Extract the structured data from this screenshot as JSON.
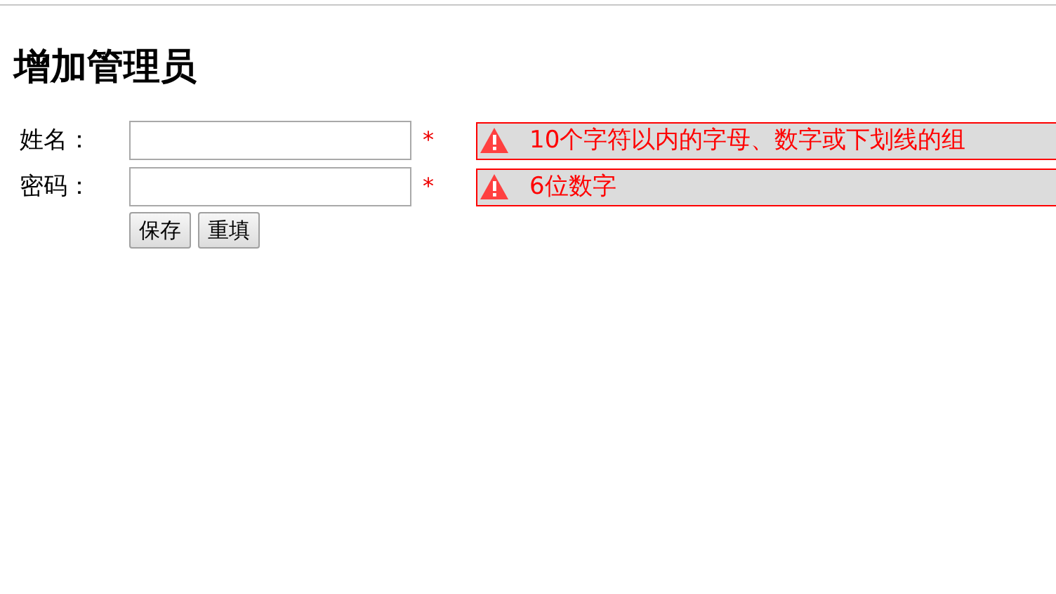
{
  "title": "增加管理员",
  "fields": [
    {
      "label": "姓名：",
      "required_mark": "*",
      "hint": "10个字符以内的字母、数字或下划线的组"
    },
    {
      "label": "密码：",
      "required_mark": "*",
      "hint": "6位数字"
    }
  ],
  "buttons": [
    "保存",
    "重填"
  ]
}
